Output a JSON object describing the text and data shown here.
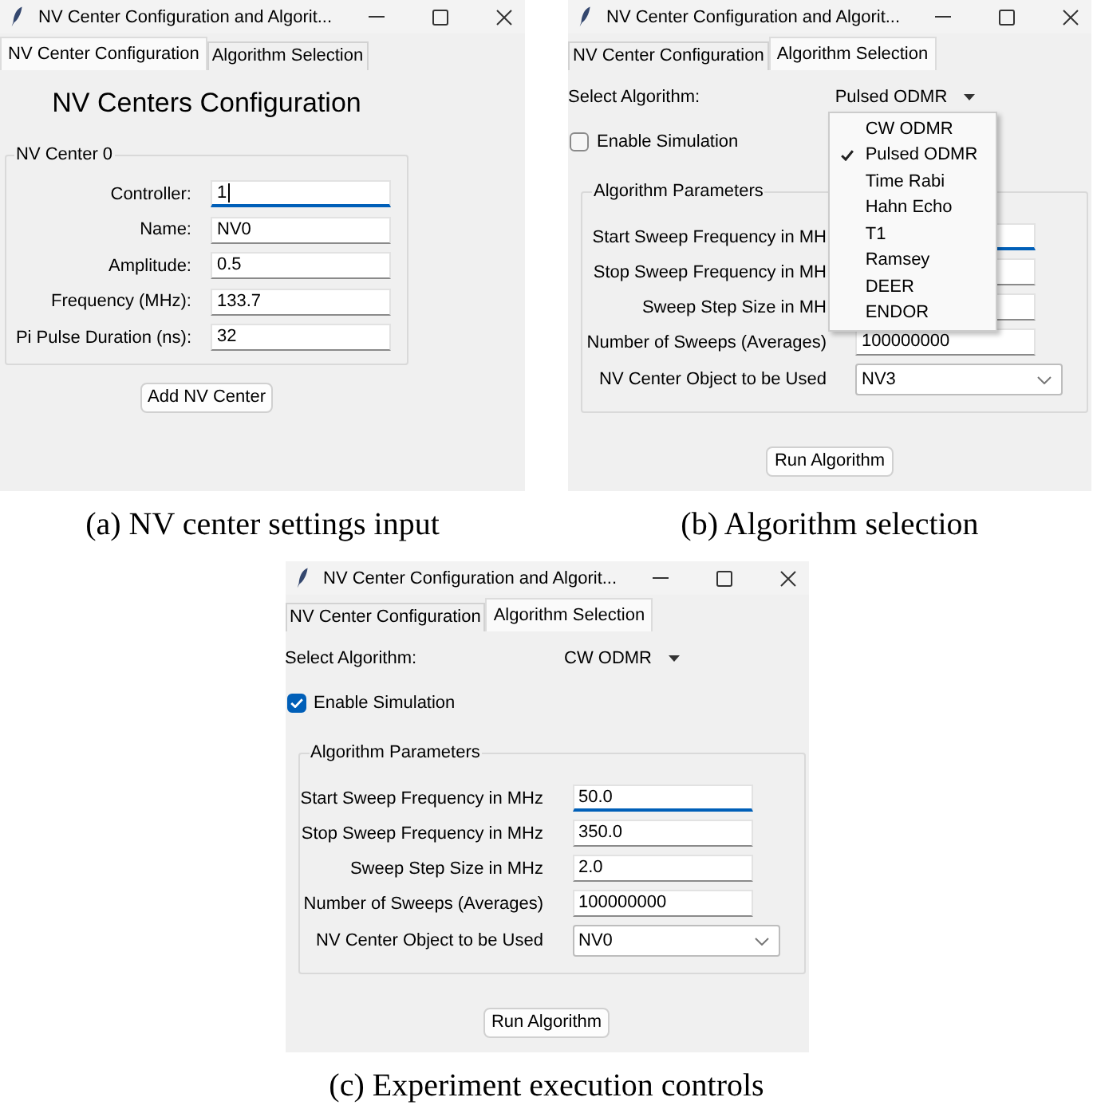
{
  "panels": [
    {
      "kind": "nv_config",
      "window": {
        "title": "NV Center Configuration and Algorit..."
      },
      "tabs": [
        {
          "label": "NV Center Configuration",
          "selected": true
        },
        {
          "label": "Algorithm Selection",
          "selected": false
        }
      ],
      "heading": "NV Centers Configuration",
      "group": {
        "title": "NV Center 0",
        "fields": [
          {
            "label": "Controller:",
            "value": "1",
            "focused": true,
            "text_cursor": true
          },
          {
            "label": "Name:",
            "value": "NV0",
            "focused": false
          },
          {
            "label": "Amplitude:",
            "value": "0.5",
            "focused": false
          },
          {
            "label": "Frequency (MHz):",
            "value": "133.7",
            "focused": false
          },
          {
            "label": "Pi Pulse Duration (ns):",
            "value": "32",
            "focused": false
          }
        ]
      },
      "button": "Add NV Center",
      "caption": "(a) NV center settings input"
    },
    {
      "kind": "algorithm",
      "window": {
        "title": "NV Center Configuration and Algorit..."
      },
      "tabs": [
        {
          "label": "NV Center Configuration",
          "selected": false
        },
        {
          "label": "Algorithm Selection",
          "selected": true
        }
      ],
      "algorithm": {
        "label": "Select Algorithm:",
        "value": "Pulsed ODMR",
        "menu": {
          "items": [
            {
              "label": "CW ODMR",
              "selected": false
            },
            {
              "label": "Pulsed ODMR",
              "selected": true
            },
            {
              "label": "Time Rabi",
              "selected": false
            },
            {
              "label": "Hahn Echo",
              "selected": false
            },
            {
              "label": "T1",
              "selected": false
            },
            {
              "label": "Ramsey",
              "selected": false
            },
            {
              "label": "DEER",
              "selected": false
            },
            {
              "label": "ENDOR",
              "selected": false
            }
          ]
        }
      },
      "simulation": {
        "label": "Enable Simulation",
        "checked": false
      },
      "parameters": {
        "title": "Algorithm Parameters",
        "fields": [
          {
            "kind": "entry",
            "label": "Start Sweep Frequency in MH",
            "focused": true
          },
          {
            "kind": "entry",
            "label": "Stop Sweep Frequency in MH",
            "focused": false
          },
          {
            "kind": "entry",
            "label": "Sweep Step Size in MH",
            "focused": false
          },
          {
            "kind": "entry",
            "label": "Number of Sweeps (Averages)",
            "value": "100000000",
            "focused": false
          },
          {
            "kind": "combobox",
            "label": "NV Center Object to be Used",
            "value": "NV3"
          }
        ]
      },
      "button": "Run Algorithm",
      "caption": "(b) Algorithm selection"
    },
    {
      "kind": "algorithm",
      "window": {
        "title": "NV Center Configuration and Algorit..."
      },
      "tabs": [
        {
          "label": "NV Center Configuration",
          "selected": false
        },
        {
          "label": "Algorithm Selection",
          "selected": true
        }
      ],
      "algorithm": {
        "label": "Select Algorithm:",
        "value": "CW ODMR"
      },
      "simulation": {
        "label": "Enable Simulation",
        "checked": true
      },
      "parameters": {
        "title": "Algorithm Parameters",
        "fields": [
          {
            "kind": "entry",
            "label": "Start Sweep Frequency in MHz",
            "value": "50.0",
            "focused": true
          },
          {
            "kind": "entry",
            "label": "Stop Sweep Frequency in MHz",
            "value": "350.0",
            "focused": false
          },
          {
            "kind": "entry",
            "label": "Sweep Step Size in MHz",
            "value": "2.0",
            "focused": false
          },
          {
            "kind": "entry",
            "label": "Number of Sweeps (Averages)",
            "value": "100000000",
            "focused": false
          },
          {
            "kind": "combobox",
            "label": "NV Center Object to be Used",
            "value": "NV0"
          }
        ]
      },
      "button": "Run Algorithm",
      "caption": "(c) Experiment execution controls"
    }
  ]
}
